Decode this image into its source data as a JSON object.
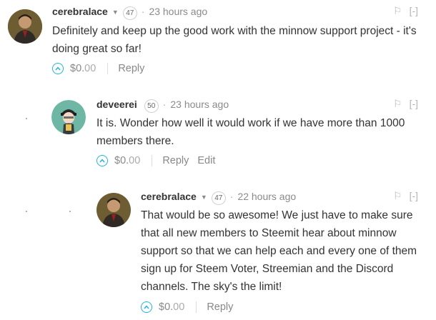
{
  "comments": [
    {
      "author": "cerebralace",
      "reputation": "47",
      "timestamp": "23 hours ago",
      "body": "Definitely and keep up the good work with the minnow support project - it's doing great so far!",
      "payout_main": "$0.",
      "payout_frac": "00",
      "reply_label": "Reply",
      "flag_icon": "flag-icon",
      "collapse_label": "[-]"
    },
    {
      "author": "deveerei",
      "reputation": "50",
      "timestamp": "23 hours ago",
      "body": "It is. Wonder how well it would work if we have more than 1000 members there.",
      "payout_main": "$0.",
      "payout_frac": "00",
      "reply_label": "Reply",
      "edit_label": "Edit",
      "flag_icon": "flag-icon",
      "collapse_label": "[-]"
    },
    {
      "author": "cerebralace",
      "reputation": "47",
      "timestamp": "22 hours ago",
      "body": "That would be so awesome! We just have to make sure that all new members to Steemit hear about minnow support so that we can help each and every one of them sign up for Steem Voter, Streemian and the Discord channels. The sky's the limit!",
      "payout_main": "$0.",
      "payout_frac": "00",
      "reply_label": "Reply",
      "flag_icon": "flag-icon",
      "collapse_label": "[-]"
    }
  ],
  "colors": {
    "upvote_accent": "#1fb5e0",
    "text": "#333333",
    "muted": "#8a8a8a"
  }
}
